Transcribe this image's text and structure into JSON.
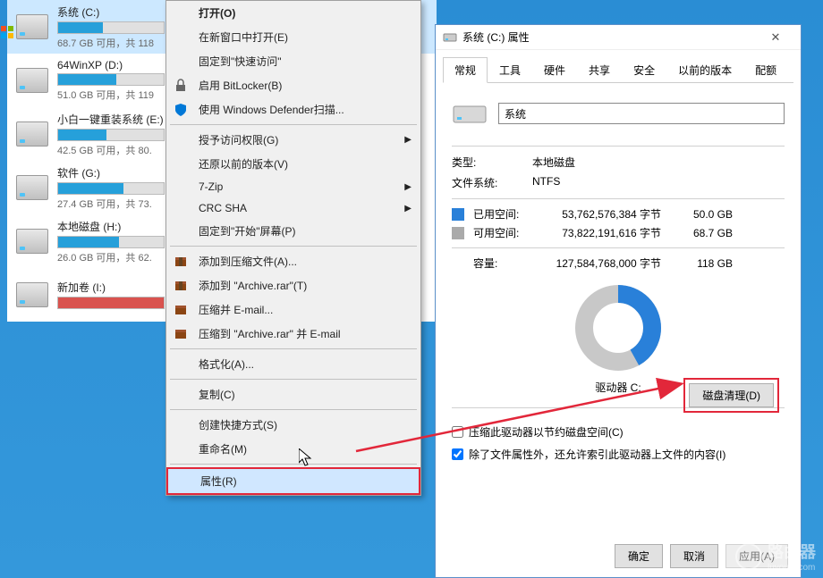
{
  "drives": [
    {
      "name": "系统 (C:)",
      "caption": "68.7 GB 可用，共 118",
      "pct": 42,
      "selected": true,
      "winflag": true
    },
    {
      "name": "64WinXP  (D:)",
      "caption": "51.0 GB 可用，共 119",
      "pct": 55
    },
    {
      "name": "小白一键重装系统 (E:)",
      "caption": "42.5 GB 可用，共 80.",
      "pct": 46
    },
    {
      "name": "软件 (G:)",
      "caption": "27.4 GB 可用，共 73.",
      "pct": 62
    },
    {
      "name": "本地磁盘 (H:)",
      "caption": "26.0 GB 可用，共 62.",
      "pct": 58
    },
    {
      "name": "新加卷 (I:)",
      "caption": "",
      "pct": 100,
      "red": true
    }
  ],
  "menu": {
    "open": "打开(O)",
    "newwin": "在新窗口中打开(E)",
    "pinquick": "固定到\"快速访问\"",
    "bitlocker": "启用 BitLocker(B)",
    "defender": "使用 Windows Defender扫描...",
    "access": "授予访问权限(G)",
    "restore": "还原以前的版本(V)",
    "sevenzip": "7-Zip",
    "crcsha": "CRC SHA",
    "pinstart": "固定到\"开始\"屏幕(P)",
    "addrar": "添加到压缩文件(A)...",
    "addarchive": "添加到 \"Archive.rar\"(T)",
    "zipemail": "压缩并 E-mail...",
    "ziparchiveemail": "压缩到 \"Archive.rar\" 并 E-mail",
    "format": "格式化(A)...",
    "copy": "复制(C)",
    "shortcut": "创建快捷方式(S)",
    "rename": "重命名(M)",
    "props": "属性(R)"
  },
  "prop": {
    "title": "系统 (C:) 属性",
    "tabs": {
      "general": "常规",
      "tools": "工具",
      "hardware": "硬件",
      "sharing": "共享",
      "security": "安全",
      "prev": "以前的版本",
      "quota": "配额"
    },
    "name": "系统",
    "type_label": "类型:",
    "type_value": "本地磁盘",
    "fs_label": "文件系统:",
    "fs_value": "NTFS",
    "used_label": "已用空间:",
    "used_bytes": "53,762,576,384 字节",
    "used_size": "50.0 GB",
    "free_label": "可用空间:",
    "free_bytes": "73,822,191,616 字节",
    "free_size": "68.7 GB",
    "cap_label": "容量:",
    "cap_bytes": "127,584,768,000 字节",
    "cap_size": "118 GB",
    "drive_letter": "驱动器 C:",
    "cleanup": "磁盘清理(D)",
    "compress": "压缩此驱动器以节约磁盘空间(C)",
    "index": "除了文件属性外，还允许索引此驱动器上文件的内容(I)",
    "ok": "确定",
    "cancel": "取消",
    "apply": "应用(A)"
  },
  "watermark": {
    "brand": "路由器",
    "sub": "luyouqi.com"
  },
  "chart_data": {
    "type": "pie",
    "title": "驱动器 C:",
    "series": [
      {
        "name": "已用空间",
        "value": 53762576384,
        "display": "50.0 GB",
        "color": "#2980d9"
      },
      {
        "name": "可用空间",
        "value": 73822191616,
        "display": "68.7 GB",
        "color": "#aaaaaa"
      }
    ],
    "total": {
      "value": 127584768000,
      "display": "118 GB"
    }
  }
}
